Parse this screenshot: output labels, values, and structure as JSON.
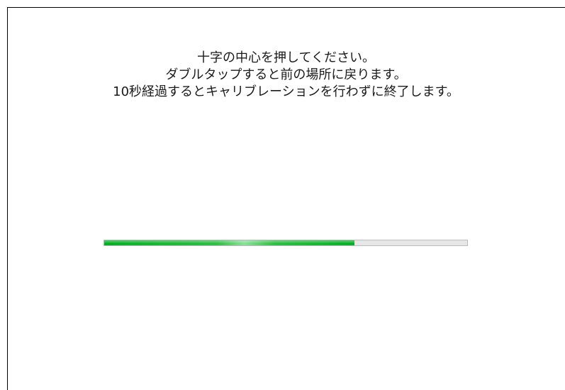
{
  "instructions": {
    "line1": "十字の中心を押してください。",
    "line2": "ダブルタップすると前の場所に戻ります。",
    "line3": "10秒経過するとキャリブレーションを行わずに終了します。"
  },
  "progress": {
    "value": 0.69,
    "color": "#06b025"
  }
}
